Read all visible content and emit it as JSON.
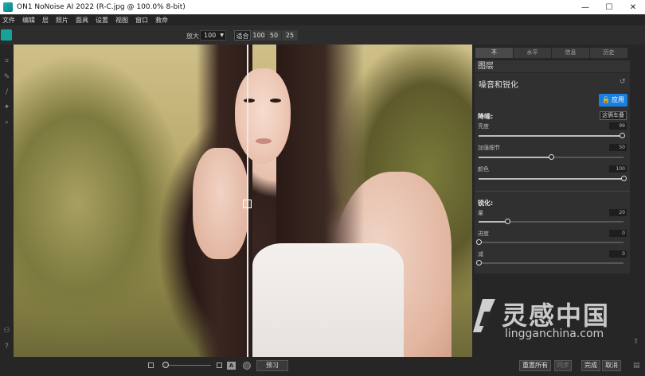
{
  "window": {
    "title": "ON1 NoNoise AI 2022 (R-C.jpg @ 100.0% 8-bit)",
    "minimize": "—",
    "maximize": "☐",
    "close": "✕"
  },
  "menu": [
    "文件",
    "编辑",
    "层",
    "照片",
    "面具",
    "设置",
    "视图",
    "窗口",
    "救命"
  ],
  "toolbar": {
    "zoom_label": "放大",
    "zoom_value": "100",
    "segments": [
      "适合",
      "100",
      "50",
      "25"
    ]
  },
  "right_panel": {
    "tabs": [
      "不",
      "水平",
      "信息",
      "历史"
    ],
    "layers_title": "图层",
    "section_title": "噪音和锐化",
    "apply_label": "应用",
    "denoise": {
      "title": "降噪:",
      "mode_button": "这俩车叠",
      "sliders": [
        {
          "label": "亮度",
          "value": "99",
          "level": 0.99
        },
        {
          "label": "加强细节",
          "value": "50",
          "level": 0.5
        },
        {
          "label": "颜色",
          "value": "100",
          "level": 1.0
        }
      ]
    },
    "sharpen": {
      "title": "锐化:",
      "sliders": [
        {
          "label": "量",
          "value": "20",
          "level": 0.2
        },
        {
          "label": "进度",
          "value": "0",
          "level": 0.0
        },
        {
          "label": "减",
          "value": "0",
          "level": 0.0
        }
      ]
    }
  },
  "bottom": {
    "preview_label": "预习",
    "reset_all": "重置所有",
    "sync": "同步",
    "done": "完成",
    "cancel": "取消",
    "a_label": "A"
  },
  "watermark": {
    "cn": "灵感中国",
    "en": "lingganchina.com"
  },
  "colors": {
    "accent": "#1a7fe0",
    "app_icon": "#16a39a"
  },
  "icons": {
    "left_tools": [
      "crop-icon",
      "brush-icon",
      "eraser-icon",
      "retouch-icon",
      "zoom-icon"
    ],
    "bottom_left": [
      "person-icon",
      "help-icon"
    ],
    "right_side": [
      "share-icon",
      "panel-icon"
    ]
  }
}
